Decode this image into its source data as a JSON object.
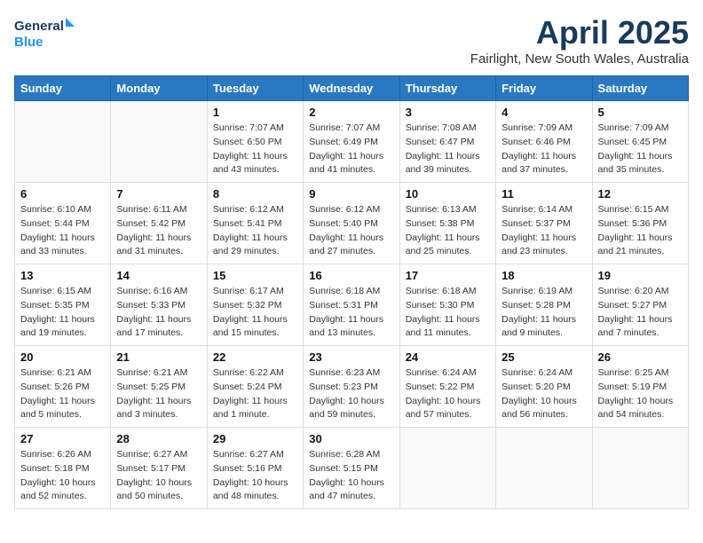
{
  "logo": {
    "line1": "General",
    "line2": "Blue"
  },
  "title": "April 2025",
  "location": "Fairlight, New South Wales, Australia",
  "headers": [
    "Sunday",
    "Monday",
    "Tuesday",
    "Wednesday",
    "Thursday",
    "Friday",
    "Saturday"
  ],
  "weeks": [
    [
      {
        "day": "",
        "info": ""
      },
      {
        "day": "",
        "info": ""
      },
      {
        "day": "1",
        "info": "Sunrise: 7:07 AM\nSunset: 6:50 PM\nDaylight: 11 hours and 43 minutes."
      },
      {
        "day": "2",
        "info": "Sunrise: 7:07 AM\nSunset: 6:49 PM\nDaylight: 11 hours and 41 minutes."
      },
      {
        "day": "3",
        "info": "Sunrise: 7:08 AM\nSunset: 6:47 PM\nDaylight: 11 hours and 39 minutes."
      },
      {
        "day": "4",
        "info": "Sunrise: 7:09 AM\nSunset: 6:46 PM\nDaylight: 11 hours and 37 minutes."
      },
      {
        "day": "5",
        "info": "Sunrise: 7:09 AM\nSunset: 6:45 PM\nDaylight: 11 hours and 35 minutes."
      }
    ],
    [
      {
        "day": "6",
        "info": "Sunrise: 6:10 AM\nSunset: 5:44 PM\nDaylight: 11 hours and 33 minutes."
      },
      {
        "day": "7",
        "info": "Sunrise: 6:11 AM\nSunset: 5:42 PM\nDaylight: 11 hours and 31 minutes."
      },
      {
        "day": "8",
        "info": "Sunrise: 6:12 AM\nSunset: 5:41 PM\nDaylight: 11 hours and 29 minutes."
      },
      {
        "day": "9",
        "info": "Sunrise: 6:12 AM\nSunset: 5:40 PM\nDaylight: 11 hours and 27 minutes."
      },
      {
        "day": "10",
        "info": "Sunrise: 6:13 AM\nSunset: 5:38 PM\nDaylight: 11 hours and 25 minutes."
      },
      {
        "day": "11",
        "info": "Sunrise: 6:14 AM\nSunset: 5:37 PM\nDaylight: 11 hours and 23 minutes."
      },
      {
        "day": "12",
        "info": "Sunrise: 6:15 AM\nSunset: 5:36 PM\nDaylight: 11 hours and 21 minutes."
      }
    ],
    [
      {
        "day": "13",
        "info": "Sunrise: 6:15 AM\nSunset: 5:35 PM\nDaylight: 11 hours and 19 minutes."
      },
      {
        "day": "14",
        "info": "Sunrise: 6:16 AM\nSunset: 5:33 PM\nDaylight: 11 hours and 17 minutes."
      },
      {
        "day": "15",
        "info": "Sunrise: 6:17 AM\nSunset: 5:32 PM\nDaylight: 11 hours and 15 minutes."
      },
      {
        "day": "16",
        "info": "Sunrise: 6:18 AM\nSunset: 5:31 PM\nDaylight: 11 hours and 13 minutes."
      },
      {
        "day": "17",
        "info": "Sunrise: 6:18 AM\nSunset: 5:30 PM\nDaylight: 11 hours and 11 minutes."
      },
      {
        "day": "18",
        "info": "Sunrise: 6:19 AM\nSunset: 5:28 PM\nDaylight: 11 hours and 9 minutes."
      },
      {
        "day": "19",
        "info": "Sunrise: 6:20 AM\nSunset: 5:27 PM\nDaylight: 11 hours and 7 minutes."
      }
    ],
    [
      {
        "day": "20",
        "info": "Sunrise: 6:21 AM\nSunset: 5:26 PM\nDaylight: 11 hours and 5 minutes."
      },
      {
        "day": "21",
        "info": "Sunrise: 6:21 AM\nSunset: 5:25 PM\nDaylight: 11 hours and 3 minutes."
      },
      {
        "day": "22",
        "info": "Sunrise: 6:22 AM\nSunset: 5:24 PM\nDaylight: 11 hours and 1 minute."
      },
      {
        "day": "23",
        "info": "Sunrise: 6:23 AM\nSunset: 5:23 PM\nDaylight: 10 hours and 59 minutes."
      },
      {
        "day": "24",
        "info": "Sunrise: 6:24 AM\nSunset: 5:22 PM\nDaylight: 10 hours and 57 minutes."
      },
      {
        "day": "25",
        "info": "Sunrise: 6:24 AM\nSunset: 5:20 PM\nDaylight: 10 hours and 56 minutes."
      },
      {
        "day": "26",
        "info": "Sunrise: 6:25 AM\nSunset: 5:19 PM\nDaylight: 10 hours and 54 minutes."
      }
    ],
    [
      {
        "day": "27",
        "info": "Sunrise: 6:26 AM\nSunset: 5:18 PM\nDaylight: 10 hours and 52 minutes."
      },
      {
        "day": "28",
        "info": "Sunrise: 6:27 AM\nSunset: 5:17 PM\nDaylight: 10 hours and 50 minutes."
      },
      {
        "day": "29",
        "info": "Sunrise: 6:27 AM\nSunset: 5:16 PM\nDaylight: 10 hours and 48 minutes."
      },
      {
        "day": "30",
        "info": "Sunrise: 6:28 AM\nSunset: 5:15 PM\nDaylight: 10 hours and 47 minutes."
      },
      {
        "day": "",
        "info": ""
      },
      {
        "day": "",
        "info": ""
      },
      {
        "day": "",
        "info": ""
      }
    ]
  ]
}
